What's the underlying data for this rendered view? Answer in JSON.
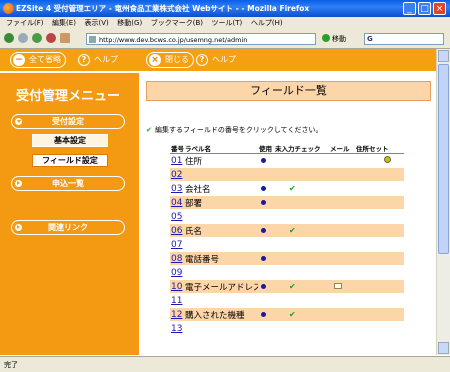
{
  "window": {
    "title": "EZSite 4 受付管理エリア - 竜州食品工業株式会社 Webサイト - - Mozilla Firefox"
  },
  "menubar": [
    "ファイル(F)",
    "編集(E)",
    "表示(V)",
    "移動(G)",
    "ブックマーク(B)",
    "ツール(T)",
    "ヘルプ(H)"
  ],
  "navbar": {
    "url": "http://www.dev.bcws.co.jp/usemng.net/admin",
    "go_label": "移動",
    "search_letter": "G"
  },
  "topbar": {
    "collapse_all": "全て省略",
    "help1": "ヘルプ",
    "close": "閉じる",
    "help2": "ヘルプ"
  },
  "sidebar": {
    "title": "受付管理メニュー",
    "section1": "受付設定",
    "sub1": "基本設定",
    "sub2": "フィールド設定",
    "section2": "申込一覧",
    "section3": "関連リンク"
  },
  "main": {
    "title": "フィールド一覧",
    "instruction": "編集するフィールドの番号をクリックしてください。",
    "headers": [
      "番号",
      "ラベル名",
      "使用",
      "未入力チェック",
      "メール",
      "住所セット"
    ],
    "rows": [
      {
        "num": "01",
        "label": "住所",
        "used": true,
        "required": false,
        "mail": false,
        "address": true
      },
      {
        "num": "02",
        "label": "",
        "used": false,
        "required": false,
        "mail": false,
        "address": false
      },
      {
        "num": "03",
        "label": "会社名",
        "used": true,
        "required": true,
        "mail": false,
        "address": false
      },
      {
        "num": "04",
        "label": "部署",
        "used": true,
        "required": false,
        "mail": false,
        "address": false
      },
      {
        "num": "05",
        "label": "",
        "used": false,
        "required": false,
        "mail": false,
        "address": false
      },
      {
        "num": "06",
        "label": "氏名",
        "used": true,
        "required": true,
        "mail": false,
        "address": false
      },
      {
        "num": "07",
        "label": "",
        "used": false,
        "required": false,
        "mail": false,
        "address": false
      },
      {
        "num": "08",
        "label": "電話番号",
        "used": true,
        "required": false,
        "mail": false,
        "address": false
      },
      {
        "num": "09",
        "label": "",
        "used": false,
        "required": false,
        "mail": false,
        "address": false
      },
      {
        "num": "10",
        "label": "電子メールアドレス",
        "used": true,
        "required": true,
        "mail": true,
        "address": false
      },
      {
        "num": "11",
        "label": "",
        "used": false,
        "required": false,
        "mail": false,
        "address": false
      },
      {
        "num": "12",
        "label": "購入された機種",
        "used": true,
        "required": true,
        "mail": false,
        "address": false
      },
      {
        "num": "13",
        "label": "",
        "used": false,
        "required": false,
        "mail": false,
        "address": false
      }
    ]
  },
  "status": {
    "text": "完了"
  }
}
